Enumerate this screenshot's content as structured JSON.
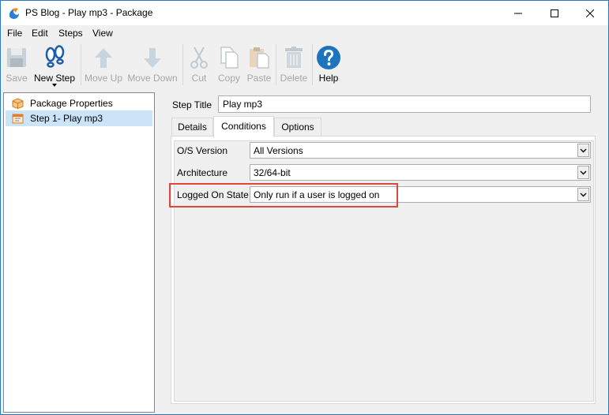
{
  "window": {
    "title": "PS Blog - Play mp3 - Package",
    "controls": {
      "minimize": "minimize",
      "maximize": "maximize",
      "close": "close"
    }
  },
  "menu": [
    "File",
    "Edit",
    "Steps",
    "View"
  ],
  "toolbar": {
    "save": "Save",
    "new_step": "New Step",
    "move_up": "Move Up",
    "move_down": "Move Down",
    "cut": "Cut",
    "copy": "Copy",
    "paste": "Paste",
    "delete": "Delete",
    "help": "Help"
  },
  "tree": {
    "items": [
      {
        "label": "Package Properties",
        "icon": "package-icon",
        "selected": false
      },
      {
        "label": "Step 1- Play mp3",
        "icon": "step-icon",
        "selected": true
      }
    ]
  },
  "step": {
    "title_label": "Step Title",
    "title_value": "Play mp3"
  },
  "tabs": [
    {
      "label": "Details",
      "active": false
    },
    {
      "label": "Conditions",
      "active": true
    },
    {
      "label": "Options",
      "active": false
    }
  ],
  "conditions": {
    "os_version": {
      "label": "O/S Version",
      "value": "All Versions"
    },
    "architecture": {
      "label": "Architecture",
      "value": "32/64-bit"
    },
    "logged_on_state": {
      "label": "Logged On State",
      "value": "Only run if a user is logged on"
    }
  },
  "colors": {
    "highlight": "#e0463c",
    "selection": "#cce4f7",
    "help_blue": "#1e73be",
    "window_border": "#2b78c2"
  }
}
